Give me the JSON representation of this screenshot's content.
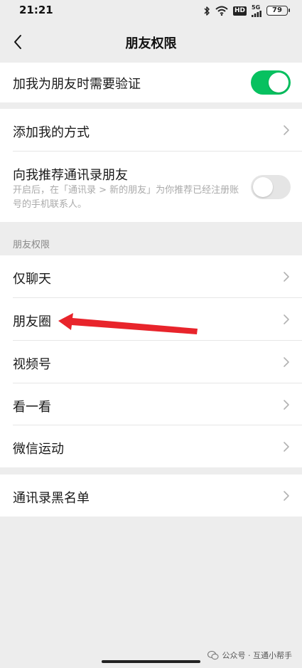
{
  "status_bar": {
    "time": "21:21",
    "hd_label": "HD",
    "signal_label": "5G",
    "battery_level": "79"
  },
  "nav": {
    "title": "朋友权限"
  },
  "verify_row": {
    "label": "加我为朋友时需要验证",
    "toggle_on": true
  },
  "add_me_row": {
    "label": "添加我的方式"
  },
  "recommend_row": {
    "label": "向我推荐通讯录朋友",
    "description": "开启后，在「通讯录 > 新的朋友」为你推荐已经注册账号的手机联系人。",
    "toggle_on": false
  },
  "section": {
    "header": "朋友权限",
    "items": [
      {
        "label": "仅聊天"
      },
      {
        "label": "朋友圈"
      },
      {
        "label": "视频号"
      },
      {
        "label": "看一看"
      },
      {
        "label": "微信运动"
      }
    ]
  },
  "blacklist_row": {
    "label": "通讯录黑名单"
  },
  "watermark": {
    "text": "公众号 · 互通小帮手"
  },
  "colors": {
    "accent_green": "#07c160",
    "annotation_red": "#e8242b",
    "background": "#ededed"
  },
  "icons": [
    "wifi-icon",
    "bluetooth-icon",
    "signal-icon",
    "battery-icon",
    "back-arrow-icon",
    "chevron-right-icon",
    "wechat-icon"
  ]
}
